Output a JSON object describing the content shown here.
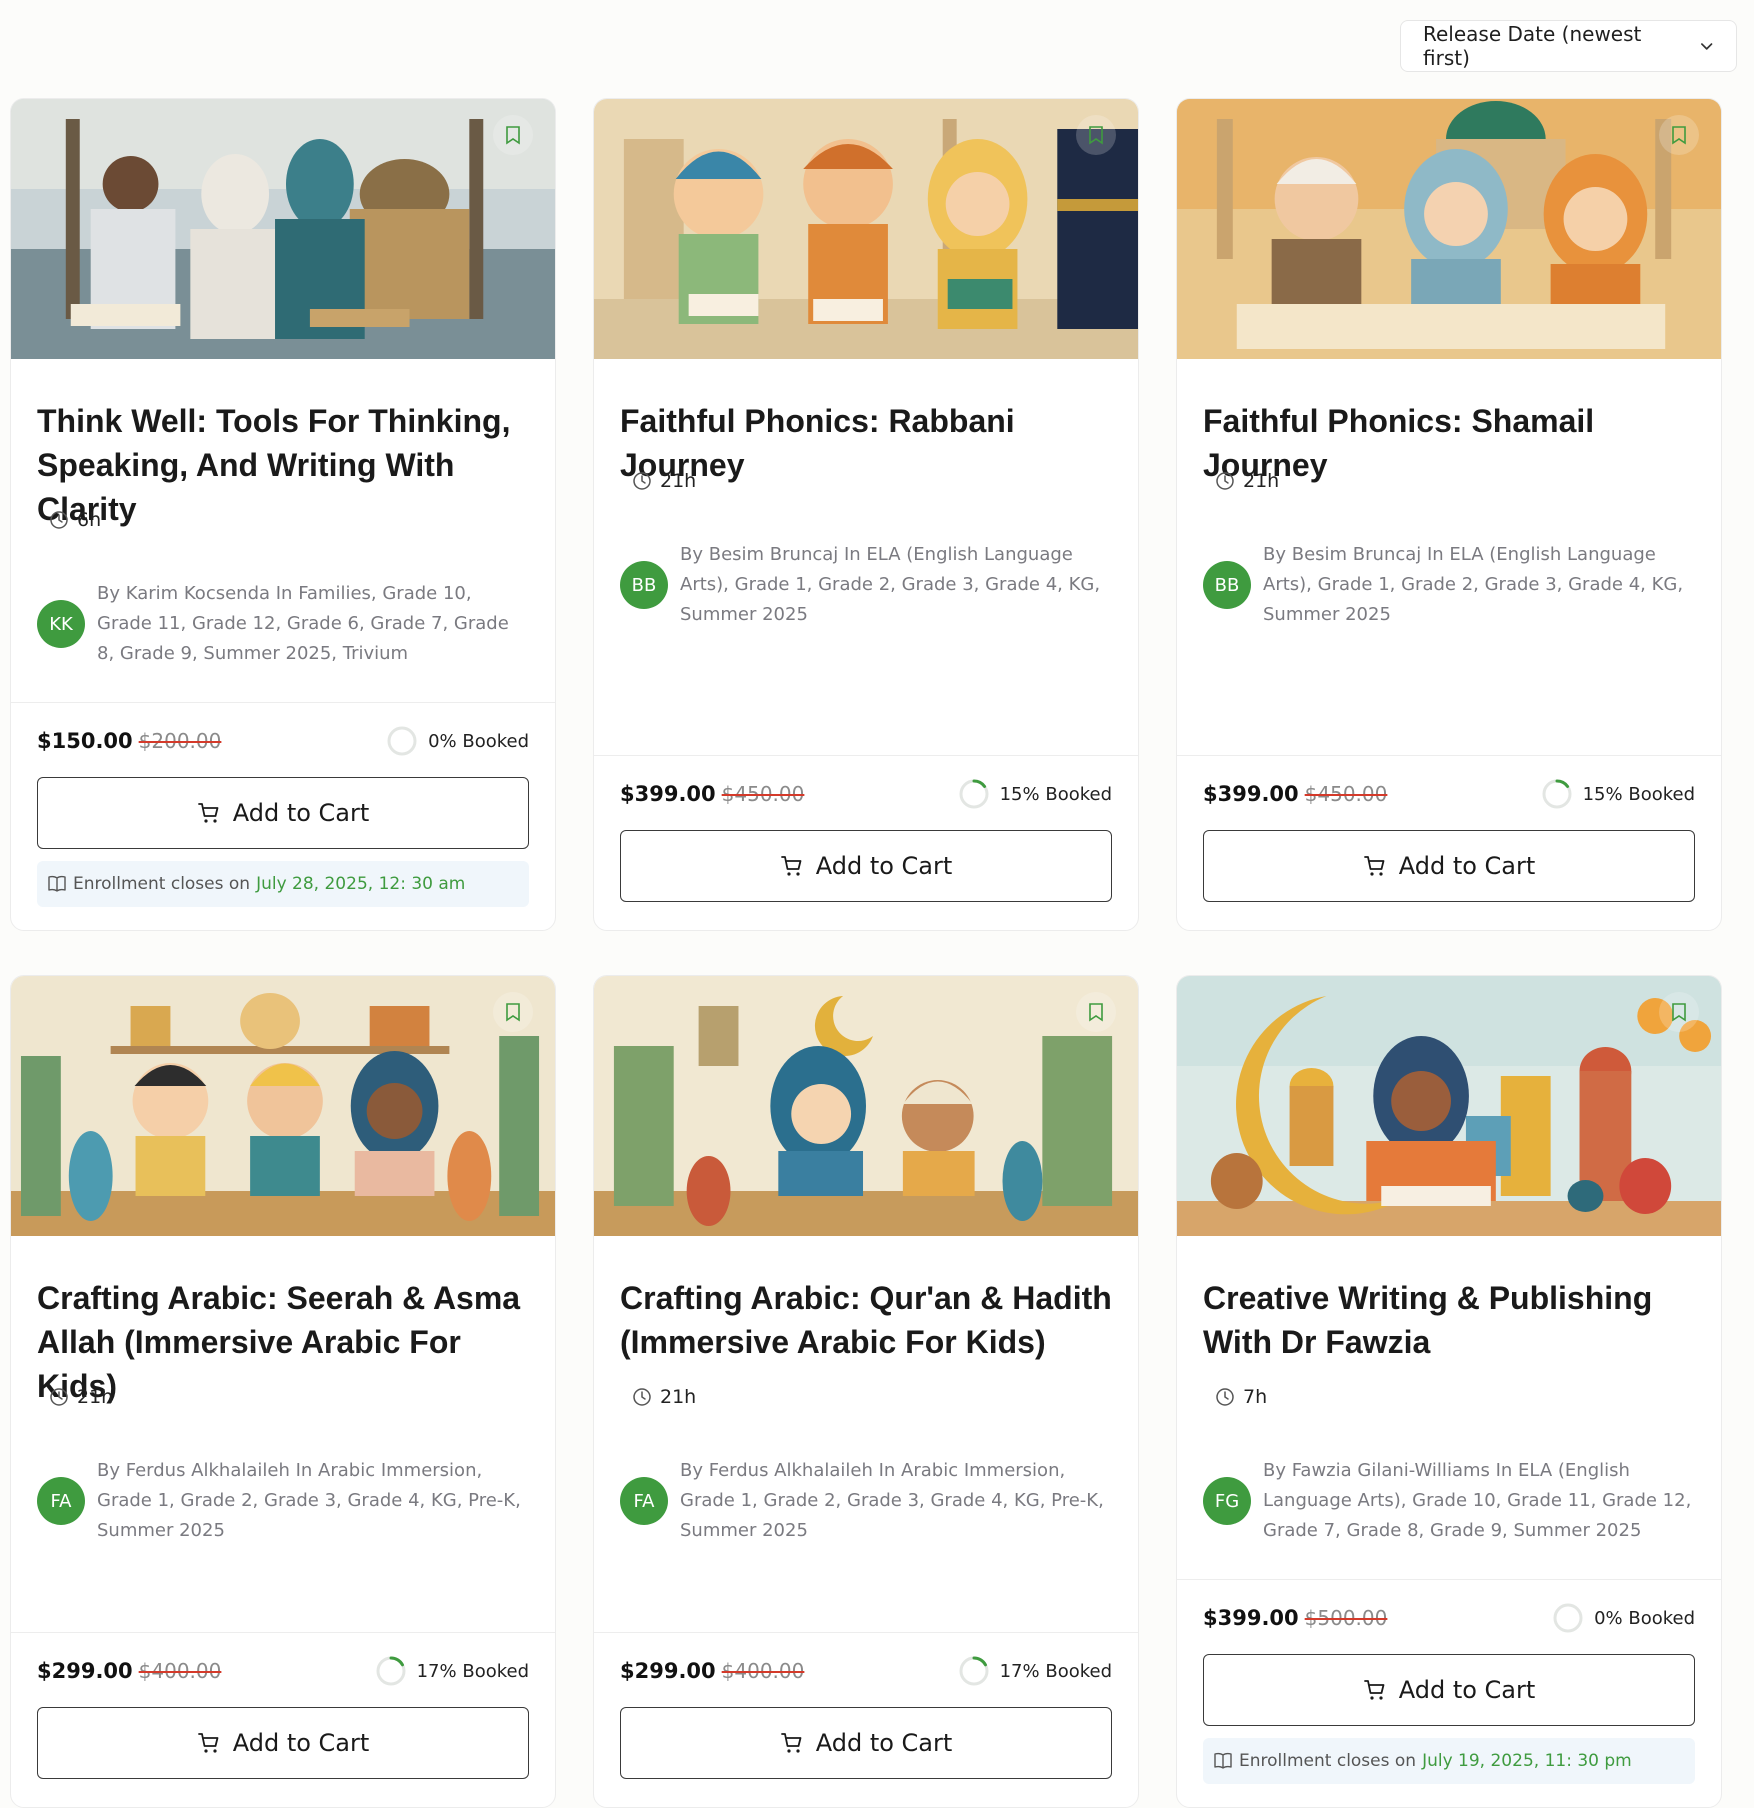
{
  "sort": {
    "label": "Release Date (newest first)"
  },
  "colors": {
    "accent_green": "#3f9b3f",
    "strike_red": "#d43a2a",
    "enroll_bg": "#f0f6fb"
  },
  "cards": [
    {
      "title": "Think Well: Tools For Thinking, Speaking, And Writing With Clarity",
      "duration": "6h",
      "initials": "KK",
      "byline": "By Karim Kocsenda In Families, Grade 10, Grade 11, Grade 12, Grade 6, Grade 7, Grade 8, Grade 9, Summer 2025, Trivium",
      "price": "$150.00",
      "old_price": "$200.00",
      "booked_percent": 0,
      "booked_label": "0% Booked",
      "cart_label": "Add to Cart",
      "enroll_label": "Enrollment closes on",
      "enroll_date": "July 28, 2025, 12: 30 am",
      "image": "illustration-mosque-children-reading"
    },
    {
      "title": "Faithful Phonics: Rabbani Journey",
      "duration": "21h",
      "initials": "BB",
      "byline": "By Besim Bruncaj In ELA (English Language Arts), Grade 1, Grade 2, Grade 3, Grade 4, KG, Summer 2025",
      "price": "$399.00",
      "old_price": "$450.00",
      "booked_percent": 15,
      "booked_label": "15% Booked",
      "cart_label": "Add to Cart",
      "image": "illustration-children-reading-kaaba"
    },
    {
      "title": "Faithful Phonics: Shamail Journey",
      "duration": "21h",
      "initials": "BB",
      "byline": "By Besim Bruncaj In ELA (English Language Arts), Grade 1, Grade 2, Grade 3, Grade 4, KG, Summer 2025",
      "price": "$399.00",
      "old_price": "$450.00",
      "booked_percent": 15,
      "booked_label": "15% Booked",
      "cart_label": "Add to Cart",
      "image": "illustration-children-reading-mosque"
    },
    {
      "title": "Crafting Arabic: Seerah & Asma Allah (Immersive Arabic For Kids)",
      "duration": "21h",
      "initials": "FA",
      "byline": "By Ferdus Alkhalaileh In Arabic Immersion, Grade 1, Grade 2, Grade 3, Grade 4, KG, Pre-K, Summer 2025",
      "price": "$299.00",
      "old_price": "$400.00",
      "booked_percent": 17,
      "booked_label": "17% Booked",
      "cart_label": "Add to Cart",
      "image": "illustration-children-crafting-plants"
    },
    {
      "title": "Crafting Arabic: Qur'an & Hadith (Immersive Arabic For Kids)",
      "duration": "21h",
      "initials": "FA",
      "byline": "By Ferdus Alkhalaileh In Arabic Immersion, Grade 1, Grade 2, Grade 3, Grade 4, KG, Pre-K, Summer 2025",
      "price": "$299.00",
      "old_price": "$400.00",
      "booked_percent": 17,
      "booked_label": "17% Booked",
      "cart_label": "Add to Cart",
      "image": "illustration-children-crafting-crescent"
    },
    {
      "title": "Creative Writing & Publishing With Dr Fawzia",
      "duration": "7h",
      "initials": "FG",
      "byline": "By Fawzia Gilani-Williams In ELA (English Language Arts), Grade 10, Grade 11, Grade 12, Grade 7, Grade 8, Grade 9, Summer 2025",
      "price": "$399.00",
      "old_price": "$500.00",
      "booked_percent": 0,
      "booked_label": "0% Booked",
      "cart_label": "Add to Cart",
      "enroll_label": "Enrollment closes on",
      "enroll_date": "July 19, 2025, 11: 30 pm",
      "image": "illustration-girl-writing-crescent"
    }
  ]
}
